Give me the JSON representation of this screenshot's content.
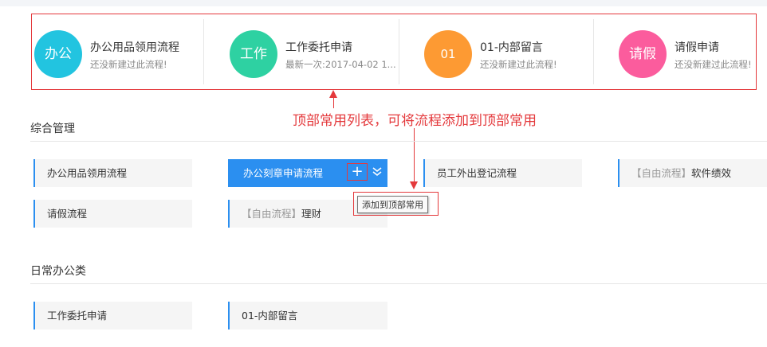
{
  "favorites": [
    {
      "icon_text": "办公",
      "title": "办公用品领用流程",
      "subtitle": "还没新建过此流程!",
      "color": "#22c4e0"
    },
    {
      "icon_text": "工作",
      "title": "工作委托申请",
      "subtitle": "最新一次:2017-04-02 1...",
      "color": "#2ed1a2"
    },
    {
      "icon_text": "01",
      "title": "01-内部留言",
      "subtitle": "还没新建过此流程!",
      "color": "#fd9a33"
    },
    {
      "icon_text": "请假",
      "title": "请假申请",
      "subtitle": "还没新建过此流程!",
      "color": "#fb5c9d"
    }
  ],
  "annotation": "顶部常用列表，可将流程添加到顶部常用",
  "sections": [
    {
      "title": "综合管理",
      "items": [
        {
          "tag": "",
          "label": "办公用品领用流程"
        },
        {
          "tag": "",
          "label": "办公刻章申请流程",
          "active": true
        },
        {
          "tag": "",
          "label": "员工外出登记流程"
        },
        {
          "tag": "【自由流程】",
          "label": "软件绩效"
        },
        {
          "tag": "",
          "label": "请假流程"
        },
        {
          "tag": "【自由流程】",
          "label": "理财"
        }
      ]
    },
    {
      "title": "日常办公类",
      "items": [
        {
          "tag": "",
          "label": "工作委托申请"
        },
        {
          "tag": "",
          "label": "01-内部留言"
        }
      ]
    }
  ],
  "add_button": {
    "icon": "plus-icon",
    "label": "+"
  },
  "expand_icon": "chevron-double-down-icon",
  "tooltip": "添加到顶部常用",
  "colors": {
    "accent": "#2b8ff0",
    "annotation": "#e4393c"
  }
}
